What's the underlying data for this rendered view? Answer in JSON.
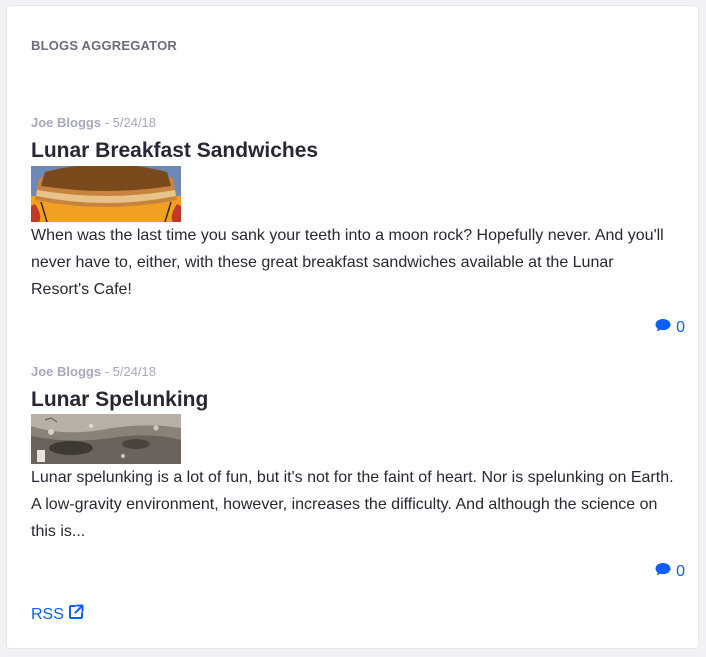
{
  "widget": {
    "title": "BLOGS AGGREGATOR"
  },
  "entries": [
    {
      "author": "Joe Bloggs",
      "separator": " - ",
      "date": "5/24/18",
      "title": "Lunar Breakfast Sandwiches",
      "summary": "When was the last time you sank your teeth into a moon rock? Hopefully never. And you'll never have to, either, with these great breakfast sandwiches available at the Lunar Resort's Cafe!",
      "comment_count": "0"
    },
    {
      "author": "Joe Bloggs",
      "separator": " - ",
      "date": "5/24/18",
      "title": "Lunar Spelunking",
      "summary": "Lunar spelunking is a lot of fun, but it's not for the faint of heart. Nor is spelunking on Earth. A low-gravity environment, however, increases the difficulty. And although the science on this is...",
      "comment_count": "0"
    }
  ],
  "footer": {
    "rss_label": "RSS"
  },
  "colors": {
    "accent": "#0b5fff",
    "meta": "#a7a9bc",
    "heading": "#272833",
    "widget_title": "#6b6c7e"
  },
  "icons": {
    "comment": "comment-icon",
    "external": "external-link-icon"
  }
}
